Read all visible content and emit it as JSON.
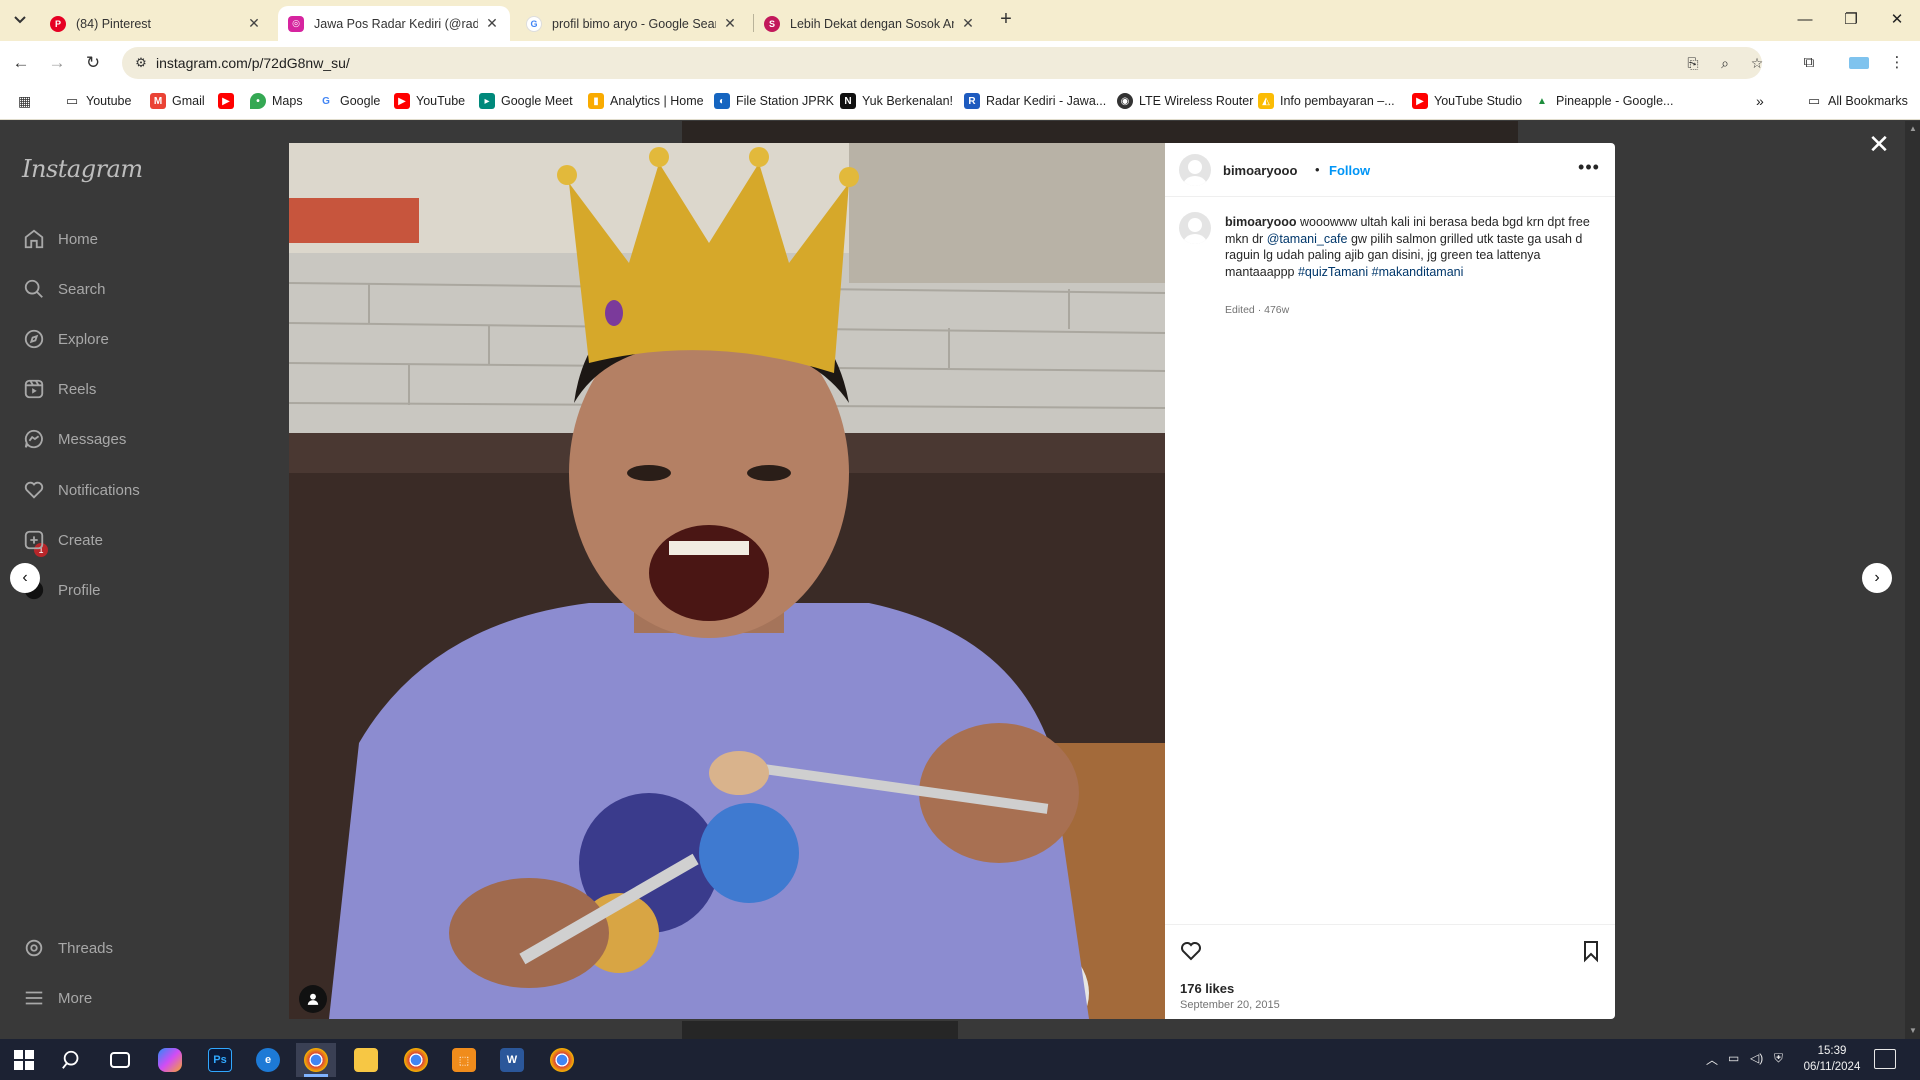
{
  "browser": {
    "tabs": [
      {
        "title": "(84) Pinterest",
        "active": false,
        "color": "#e60023"
      },
      {
        "title": "Jawa Pos Radar Kediri (@radark",
        "active": true,
        "color": "#d6249f"
      },
      {
        "title": "profil bimo aryo - Google Searc",
        "active": false,
        "color": "#4285f4"
      },
      {
        "title": "Lebih Dekat dengan Sosok Arie",
        "active": false,
        "color": "#c2185b"
      }
    ],
    "url": "instagram.com/p/72dG8nw_su/",
    "bookmarks": [
      {
        "label": "Youtube",
        "icon": "folder-icon"
      },
      {
        "label": "Gmail",
        "icon": "gmail-icon"
      },
      {
        "label": "",
        "icon": "youtube-icon"
      },
      {
        "label": "Maps",
        "icon": "maps-icon"
      },
      {
        "label": "Google",
        "icon": "google-icon"
      },
      {
        "label": "YouTube",
        "icon": "youtube-icon"
      },
      {
        "label": "Google Meet",
        "icon": "meet-icon"
      },
      {
        "label": "Analytics | Home",
        "icon": "analytics-icon"
      },
      {
        "label": "File Station JPRK",
        "icon": "file-station-icon"
      },
      {
        "label": "Yuk Berkenalan!",
        "icon": "notion-icon"
      },
      {
        "label": "Radar Kediri - Jawa...",
        "icon": "radar-icon"
      },
      {
        "label": "LTE Wireless Router",
        "icon": "router-icon"
      },
      {
        "label": "Info pembayaran –...",
        "icon": "payment-icon"
      },
      {
        "label": "YouTube Studio",
        "icon": "youtube-studio-icon"
      },
      {
        "label": "Pineapple - Google...",
        "icon": "drive-icon"
      }
    ],
    "all_bookmarks": "All Bookmarks"
  },
  "instagram": {
    "logo": "Instagram",
    "nav": [
      {
        "label": "Home",
        "icon": "home-icon"
      },
      {
        "label": "Search",
        "icon": "search-icon"
      },
      {
        "label": "Explore",
        "icon": "explore-icon"
      },
      {
        "label": "Reels",
        "icon": "reels-icon"
      },
      {
        "label": "Messages",
        "icon": "messages-icon"
      },
      {
        "label": "Notifications",
        "icon": "heart-icon"
      },
      {
        "label": "Create",
        "icon": "create-icon"
      },
      {
        "label": "Profile",
        "icon": "profile-icon"
      }
    ],
    "nav_bottom": [
      {
        "label": "Threads",
        "icon": "threads-icon"
      },
      {
        "label": "More",
        "icon": "menu-icon"
      }
    ],
    "messages_badge": "1",
    "post": {
      "username": "bimoaryooo",
      "separator": "•",
      "follow": "Follow",
      "caption_user": "bimoaryooo",
      "caption_part1": " wooowww ultah kali ini berasa beda bgd krn dpt free mkn dr ",
      "caption_mention": "@tamani_cafe",
      "caption_part2": " gw pilih salmon grilled utk taste ga usah d raguin lg udah paling ajib gan disini, jg green tea lattenya mantaaappp ",
      "caption_tag1": "#quizTamani",
      "caption_tag2": "#makanditamani",
      "caption_meta": "Edited · 476w",
      "likes": "176 likes",
      "date": "September 20, 2015"
    }
  },
  "taskbar": {
    "time": "15:39",
    "date": "06/11/2024"
  },
  "colors": {
    "follow_blue": "#0095f6",
    "link_blue": "#00376b",
    "tabstrip_bg": "#f5edcf",
    "overlay_bg": "#393939"
  }
}
